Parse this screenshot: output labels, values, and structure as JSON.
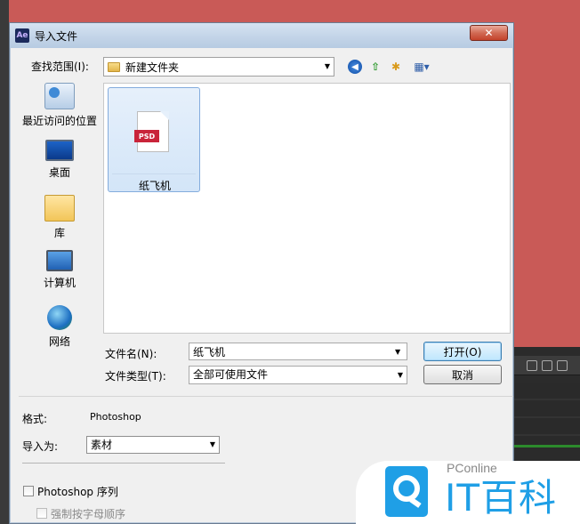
{
  "dialog": {
    "app_icon": "Ae",
    "title": "导入文件",
    "close_label": "✕"
  },
  "lookin": {
    "label": "查找范围(I):",
    "value": "新建文件夹"
  },
  "places": [
    {
      "label": "最近访问的位置",
      "icon": "recent-places-icon"
    },
    {
      "label": "桌面",
      "icon": "desktop-icon"
    },
    {
      "label": "库",
      "icon": "library-icon"
    },
    {
      "label": "计算机",
      "icon": "computer-icon"
    },
    {
      "label": "网络",
      "icon": "network-icon"
    }
  ],
  "files": [
    {
      "name": "纸飞机",
      "badge": "PSD",
      "selected": true
    }
  ],
  "filename": {
    "label": "文件名(N):",
    "value": "纸飞机"
  },
  "filetype": {
    "label": "文件类型(T):",
    "value": "全部可使用文件"
  },
  "buttons": {
    "open": "打开(O)",
    "cancel": "取消"
  },
  "format": {
    "label": "格式:",
    "value": "Photoshop"
  },
  "import_as": {
    "label": "导入为:",
    "value": "素材"
  },
  "sequence": {
    "label": "Photoshop 序列",
    "checked": false
  },
  "alphabetical": {
    "label": "强制按字母顺序",
    "checked": false,
    "disabled": true
  },
  "watermark": {
    "brand": "PConline",
    "name": "IT百科"
  },
  "colors": {
    "background": "#c95a57",
    "accent": "#1f9fe6",
    "close": "#c4432b"
  }
}
